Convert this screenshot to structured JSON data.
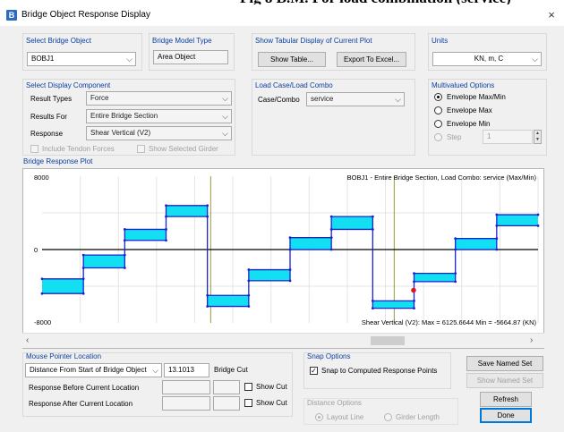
{
  "window": {
    "title": "Bridge Object Response Display",
    "app_icon": "B",
    "close_glyph": "×"
  },
  "select_bridge_object": {
    "title": "Select Bridge Object",
    "value": "BOBJ1"
  },
  "bridge_model_type": {
    "title": "Bridge Model Type",
    "value": "Area Object"
  },
  "tabular_display": {
    "title": "Show Tabular Display of Current Plot",
    "show_table": "Show Table...",
    "export": "Export To Excel..."
  },
  "units": {
    "title": "Units",
    "value": "KN, m, C"
  },
  "display_component": {
    "title": "Select Display Component",
    "result_types_label": "Result Types",
    "result_types_value": "Force",
    "results_for_label": "Results For",
    "results_for_value": "Entire Bridge Section",
    "response_label": "Response",
    "response_value": "Shear Vertical  (V2)",
    "include_tendon": "Include Tendon Forces",
    "show_selected_girder": "Show Selected Girder"
  },
  "load_case": {
    "title": "Load Case/Load Combo",
    "label": "Case/Combo",
    "value": "service"
  },
  "multivalued": {
    "title": "Multivalued Options",
    "options": [
      "Envelope Max/Min",
      "Envelope Max",
      "Envelope Min",
      "Step"
    ],
    "step_value": "1"
  },
  "plot": {
    "title": "Bridge Response Plot",
    "header": "BOBJ1 - Entire Bridge Section,  Load Combo: service (Max/Min)",
    "y_top": "8000",
    "y_mid": "0",
    "y_bottom": "-8000",
    "footer": "Shear Vertical  (V2):  Max = 6125.6644   Min = -5664.87  (KN)",
    "scroll_left": "‹",
    "scroll_right": "›"
  },
  "chart_data": {
    "type": "line",
    "title": "BOBJ1 - Entire Bridge Section,  Load Combo: service (Max/Min)",
    "ylabel": "Shear Vertical  (V2) (KN)",
    "ylim": [
      -8000,
      8000
    ],
    "y_ticks": [
      "8000",
      "0",
      "-8000"
    ],
    "series": [
      {
        "name": "Max",
        "values": [
          -3200,
          -600,
          2200,
          4800,
          -5000,
          -2200,
          1300,
          3600,
          -5600,
          -2600,
          1200,
          3800
        ]
      },
      {
        "name": "Min",
        "values": [
          -4800,
          -2000,
          1000,
          3600,
          -6200,
          -3400,
          0,
          2200,
          -6400,
          -3500,
          0,
          2600
        ]
      }
    ],
    "segments": 12,
    "max": 6125.6644,
    "min": -5664.87,
    "units": "KN"
  },
  "mouse_pointer": {
    "title": "Mouse Pointer Location",
    "combo_value": "Distance From Start of Bridge Object",
    "value": "13.1013",
    "bridge_cut": "Bridge Cut",
    "before_label": "Response Before Current Location",
    "after_label": "Response After Current Location",
    "show_cut": "Show Cut"
  },
  "snap": {
    "title": "Snap Options",
    "label": "Snap to Computed Response Points"
  },
  "distance_options": {
    "title": "Distance Options",
    "layout_line": "Layout Line",
    "girder_length": "Girder Length"
  },
  "buttons": {
    "save_named_set": "Save Named Set",
    "show_named_set": "Show Named Set",
    "refresh": "Refresh",
    "done": "Done"
  }
}
